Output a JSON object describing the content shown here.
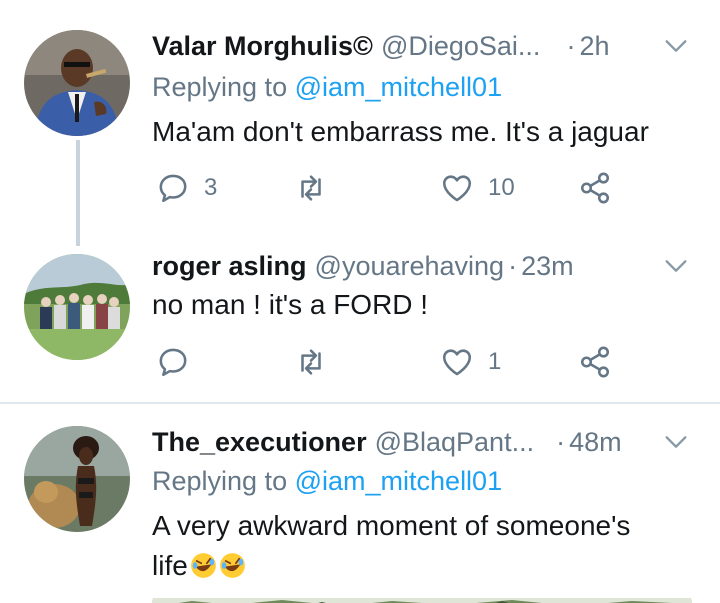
{
  "tweets": [
    {
      "name": "Valar Morghulis©",
      "handle": "@DiegoSai...",
      "dot": "·",
      "time": "2h",
      "replying_prefix": "Replying to",
      "replying_to": "@iam_mitchell01",
      "text": "Ma'am don't embarrass me. It's a jaguar",
      "reply_count": "3",
      "retweet_count": "",
      "like_count": "10"
    },
    {
      "name": "roger asling",
      "handle": "@youarehaving",
      "dot": "·",
      "time": "23m",
      "text": "no man ! it's a FORD !",
      "reply_count": "",
      "retweet_count": "",
      "like_count": "1"
    },
    {
      "name": "The_executioner",
      "handle": "@BlaqPant...",
      "dot": "·",
      "time": "48m",
      "replying_prefix": "Replying to",
      "replying_to": "@iam_mitchell01",
      "text_line1": "A very awkward moment of someone's",
      "text_line2": "life",
      "emoji": "rolling-on-floor-laughing"
    }
  ],
  "colors": {
    "text": "#14171a",
    "secondary": "#657786",
    "link": "#1da1f2",
    "divider": "#e1e8ed",
    "thread_line": "#c9d3dc"
  }
}
